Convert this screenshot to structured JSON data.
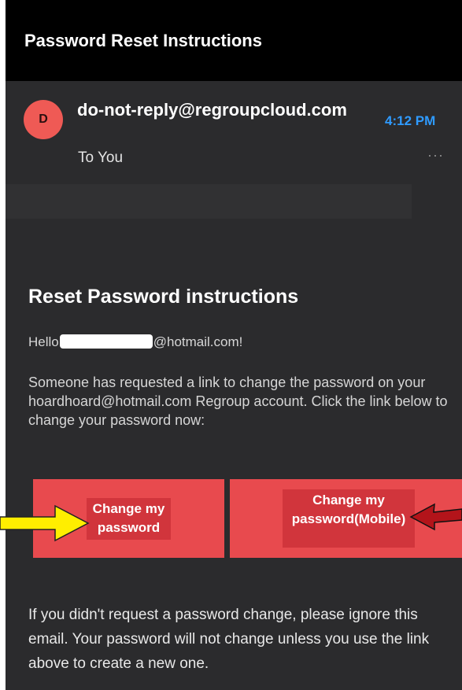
{
  "header": {
    "title": "Password Reset Instructions"
  },
  "email": {
    "avatar_letter": "D",
    "sender": "do-not-reply@regroupcloud.com",
    "to": "To You",
    "time": "4:12 PM",
    "more": "···"
  },
  "body": {
    "heading": "Reset Password instructions",
    "hello_prefix": "Hello",
    "hello_suffix": "@hotmail.com!",
    "paragraph": "Someone has requested a link to change the password on your hoardhoard@hotmail.com Regroup account. Click the link below to change your password now:",
    "button_change": "Change my password",
    "button_change_mobile": "Change my password(Mobile)",
    "footer": "If you didn't request a password change, please ignore this email. Your password will not change unless you use the link above to create a new one."
  },
  "colors": {
    "accent_blue": "#2f9bff",
    "button_red": "#e84a4e",
    "annotation_yellow": "#ffee00",
    "annotation_darkred": "#b3141a"
  }
}
